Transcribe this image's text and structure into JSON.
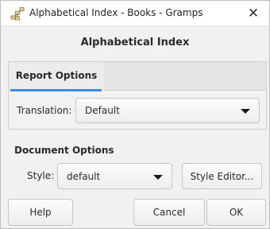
{
  "window": {
    "title": "Alphabetical Index - Books - Gramps",
    "close_glyph": "✕",
    "app_icon": "gramps-tree-icon"
  },
  "dialog": {
    "heading": "Alphabetical Index"
  },
  "tabs": [
    {
      "label": "Report Options",
      "selected": true
    }
  ],
  "report_options": {
    "translation_label": "Translation:",
    "translation_value": "Default"
  },
  "document_options": {
    "section_label": "Document Options",
    "style_label": "Style:",
    "style_value": "default",
    "style_editor_label": "Style Editor..."
  },
  "buttons": {
    "help": "Help",
    "cancel": "Cancel",
    "ok": "OK"
  },
  "colors": {
    "tab_accent": "#3d8ee0"
  }
}
